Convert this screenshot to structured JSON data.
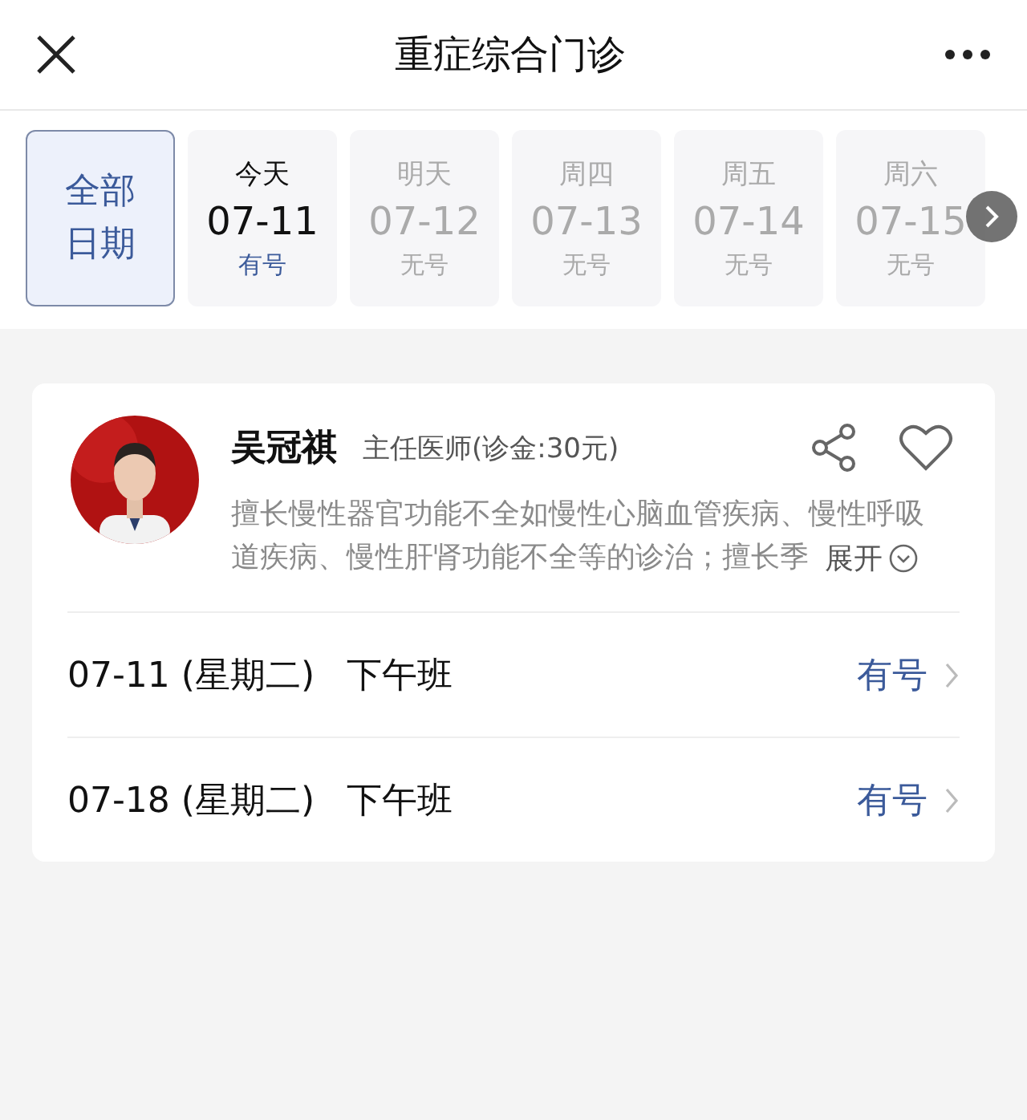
{
  "header": {
    "title": "重症综合门诊"
  },
  "date_tabs": [
    {
      "kind": "all",
      "label": "全部日期",
      "selected": true
    },
    {
      "kind": "day",
      "label": "今天",
      "date": "07-11",
      "status": "有号",
      "available": true,
      "selected": false
    },
    {
      "kind": "day",
      "label": "明天",
      "date": "07-12",
      "status": "无号",
      "available": false,
      "selected": false
    },
    {
      "kind": "day",
      "label": "周四",
      "date": "07-13",
      "status": "无号",
      "available": false,
      "selected": false
    },
    {
      "kind": "day",
      "label": "周五",
      "date": "07-14",
      "status": "无号",
      "available": false,
      "selected": false
    },
    {
      "kind": "day",
      "label": "周六",
      "date": "07-15",
      "status": "无号",
      "available": false,
      "selected": false
    }
  ],
  "doctor": {
    "name": "吴冠祺",
    "title": "主任医师(诊金:30元)",
    "favorite": false,
    "description_lines": [
      "擅长慢性器官功能不全如慢性心脑血管疾病、慢性呼吸",
      "道疾病、慢性肝肾功能不全等的诊治；擅长季"
    ],
    "expand_label": "展开",
    "schedule": [
      {
        "date": "07-11 (星期二)",
        "shift": "下午班",
        "status": "有号",
        "available": true
      },
      {
        "date": "07-18 (星期二)",
        "shift": "下午班",
        "status": "有号",
        "available": true
      }
    ]
  }
}
